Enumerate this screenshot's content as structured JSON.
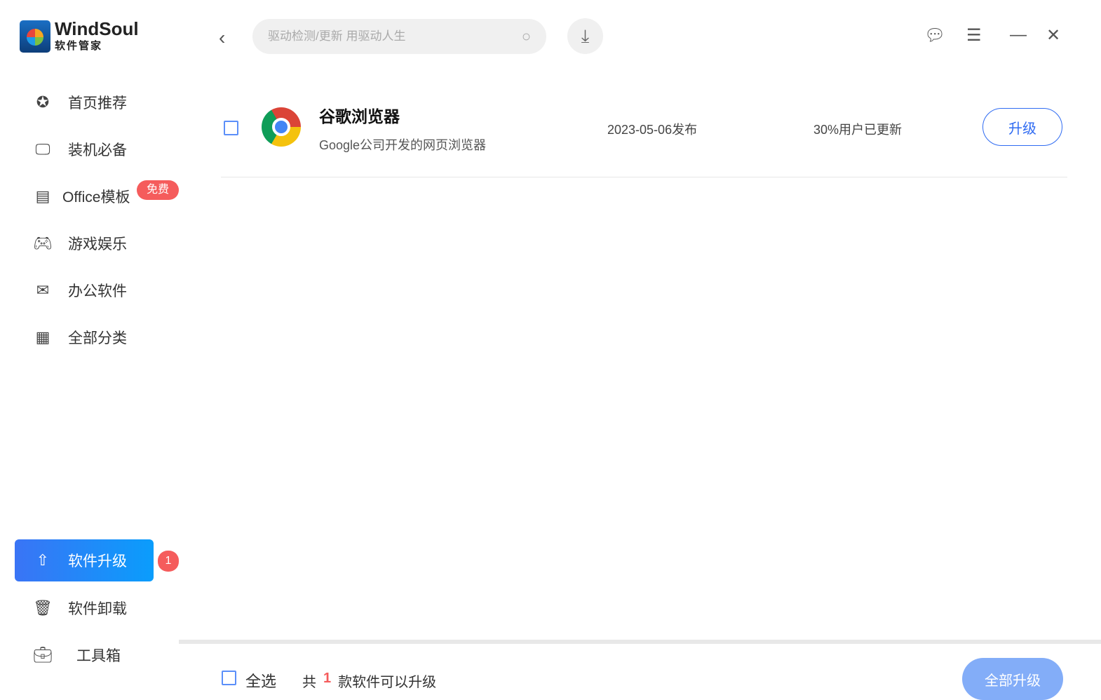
{
  "app": {
    "logo_name": "WindSoul",
    "logo_sub": "软件管家"
  },
  "search": {
    "placeholder": "驱动检测/更新 用驱动人生"
  },
  "sidebar": {
    "items": [
      {
        "label": "首页推荐",
        "icon": "star-circle-icon"
      },
      {
        "label": "装机必备",
        "icon": "monitor-check-icon"
      },
      {
        "label": "Office模板",
        "icon": "document-tray-icon",
        "badge": "免费"
      },
      {
        "label": "游戏娱乐",
        "icon": "gamepad-icon"
      },
      {
        "label": "办公软件",
        "icon": "mail-box-icon"
      },
      {
        "label": "全部分类",
        "icon": "grid-icon"
      },
      {
        "label": "软件升级",
        "icon": "upload-circle-icon",
        "badge": "1",
        "active": true
      },
      {
        "label": "软件卸载",
        "icon": "trash-icon"
      },
      {
        "label": "工具箱",
        "icon": "toolbox-icon"
      }
    ]
  },
  "list": [
    {
      "name": "谷歌浏览器",
      "desc": "Google公司开发的网页浏览器",
      "date": "2023-05-06发布",
      "updated": "30%用户已更新",
      "button": "升级"
    }
  ],
  "footer": {
    "select_all": "全选",
    "prefix": "共",
    "count": "1",
    "suffix": "款软件可以升级",
    "upgrade_all": "全部升级"
  },
  "colors": {
    "accent": "#2f6bf2",
    "badge": "#f55c5c"
  }
}
